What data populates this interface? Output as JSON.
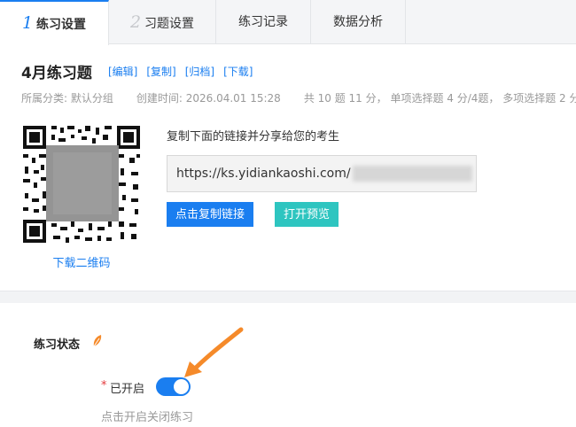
{
  "tabs": [
    {
      "num": "1",
      "label": "练习设置"
    },
    {
      "num": "2",
      "label": "习题设置"
    },
    {
      "label": "练习记录"
    },
    {
      "label": "数据分析"
    }
  ],
  "header": {
    "title": "4月练习题",
    "actions": [
      "[编辑]",
      "[复制]",
      "[归档]",
      "[下载]"
    ],
    "meta": {
      "category": "所属分类: 默认分组",
      "created": "创建时间: 2026.04.01 15:28",
      "summary": "共 10 题 11 分， 单项选择题 4 分/4题， 多项选择题 2 分/"
    }
  },
  "share": {
    "qr_download": "下载二维码",
    "tip": "复制下面的链接并分享给您的考生",
    "url_prefix": "https://ks.yidiankaoshi.com/",
    "copy_button": "点击复制链接",
    "preview_button": "打开预览"
  },
  "status": {
    "section_label": "练习状态",
    "required_mark": "*",
    "open_label": "已开启",
    "toggle_on": true,
    "hint": "点击开启关闭练习"
  },
  "colors": {
    "accent": "#1a7ef0",
    "teal": "#2ec5c0",
    "arrow": "#f58a2a",
    "required": "#e4393c"
  }
}
